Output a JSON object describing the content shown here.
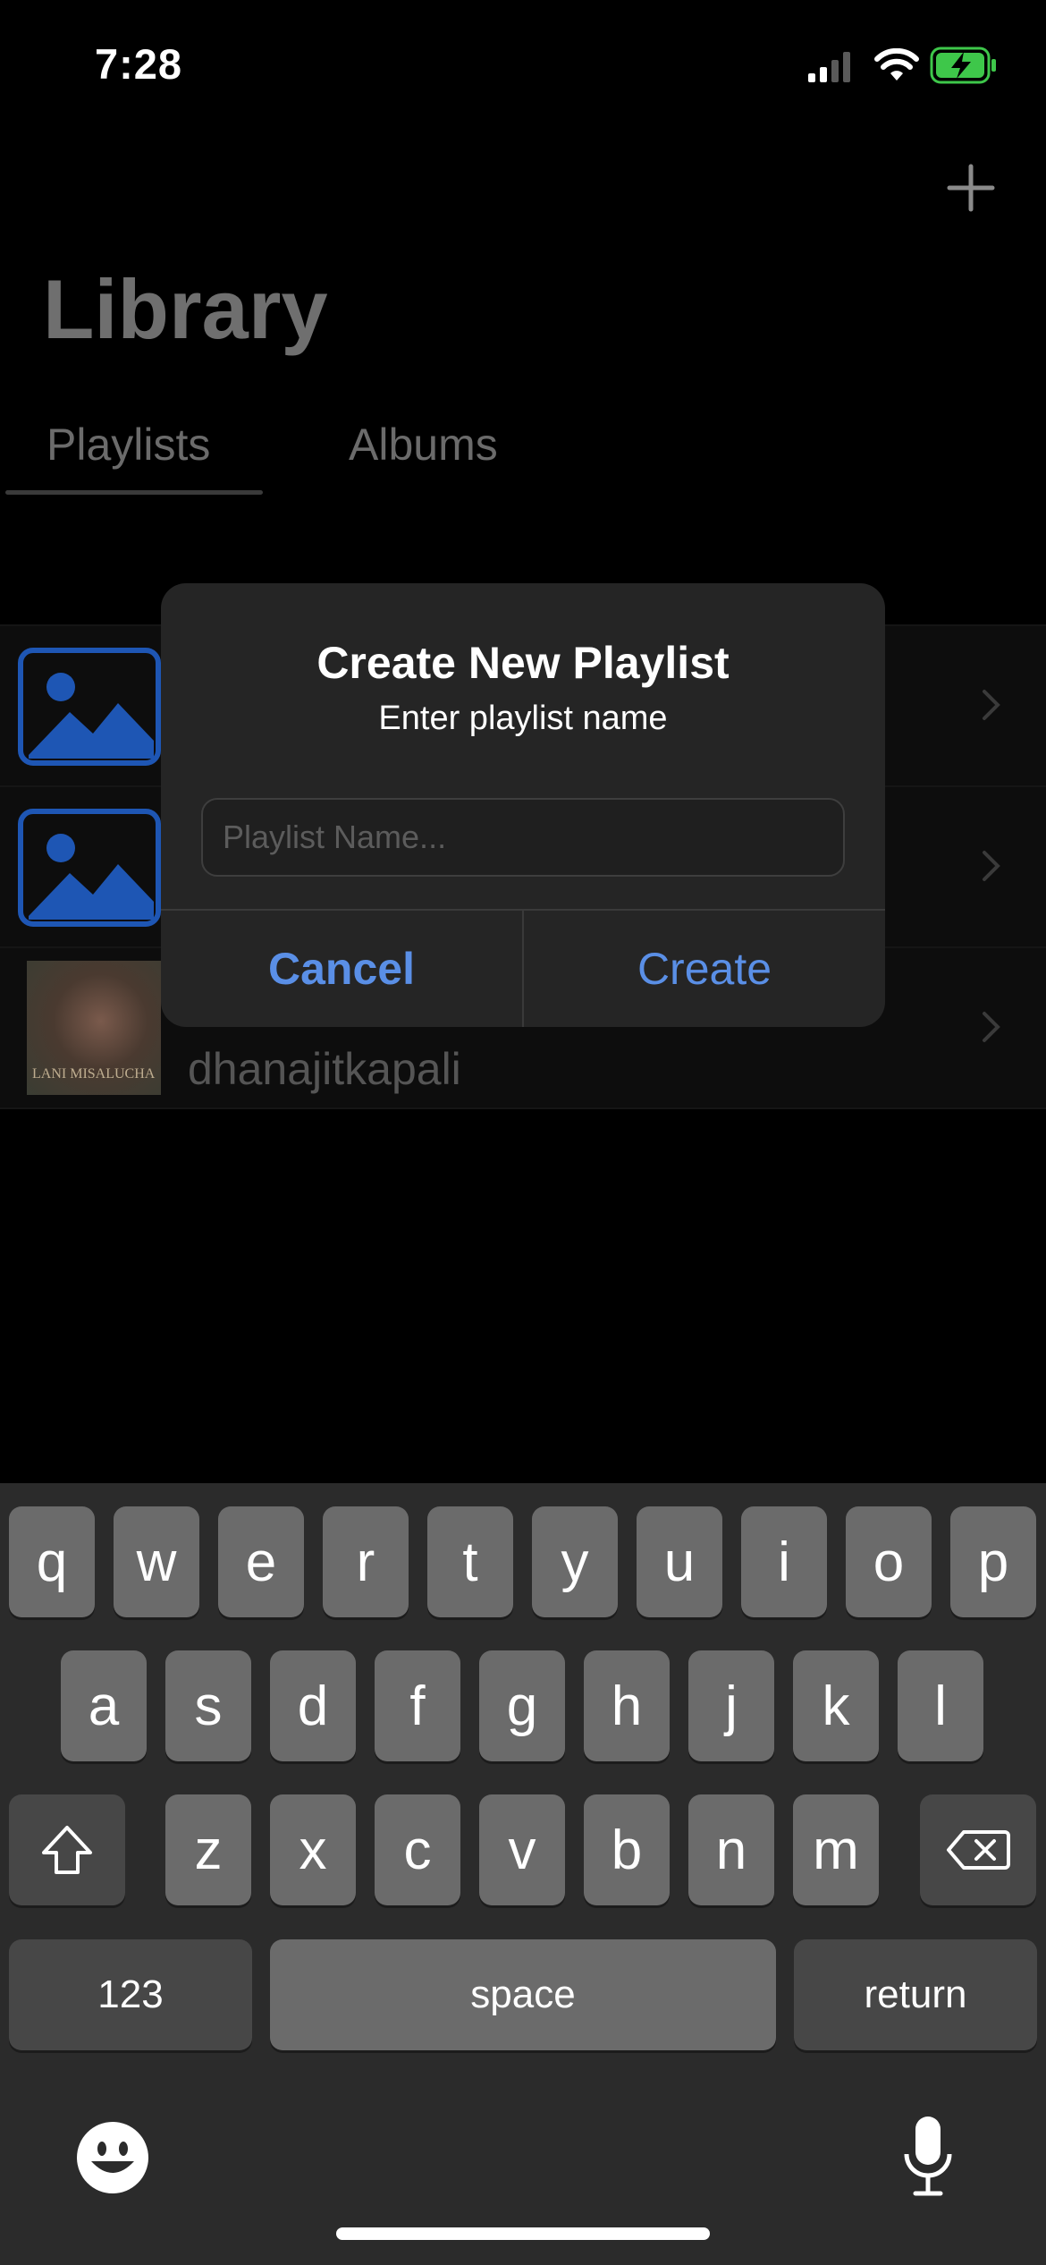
{
  "status_bar": {
    "time": "7:28"
  },
  "header": {
    "title": "Library",
    "add_icon": "plus-icon"
  },
  "tabs": [
    {
      "label": "Playlists",
      "selected": true
    },
    {
      "label": "Albums",
      "selected": false
    }
  ],
  "list": {
    "rows": [
      {
        "thumb": "image-placeholder-icon",
        "owner": ""
      },
      {
        "thumb": "image-placeholder-icon",
        "owner": ""
      },
      {
        "thumb": "album-art",
        "owner": "dhanajitkapali",
        "art_text": "LANI MISALUCHA"
      }
    ]
  },
  "dialog": {
    "title": "Create New Playlist",
    "message": "Enter playlist name",
    "input_value": "",
    "input_placeholder": "Playlist Name...",
    "cancel_label": "Cancel",
    "create_label": "Create"
  },
  "keyboard": {
    "row1": [
      "q",
      "w",
      "e",
      "r",
      "t",
      "y",
      "u",
      "i",
      "o",
      "p"
    ],
    "row2": [
      "a",
      "s",
      "d",
      "f",
      "g",
      "h",
      "j",
      "k",
      "l"
    ],
    "row3": [
      "z",
      "x",
      "c",
      "v",
      "b",
      "n",
      "m"
    ],
    "numbers_label": "123",
    "space_label": "space",
    "return_label": "return"
  },
  "colors": {
    "accent": "#5a8fe6",
    "background": "#000000",
    "placeholder_blue": "#1e56b4"
  }
}
